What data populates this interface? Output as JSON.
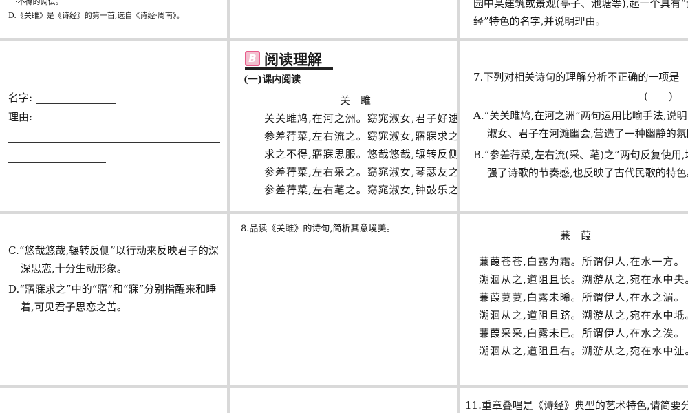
{
  "top_left_cell": {
    "line_fragment": "·不得的调伝。",
    "option_d_note": "D.《关雎》是《诗经》的第一首,选自《诗经·周南》。"
  },
  "top_right_cell": {
    "line1": "园中某建筑或景观(亭子、池塘等),起一个具有“诗",
    "line2": "经”特色的名字,并说明理由。"
  },
  "answer_cell": {
    "name_label": "名字:",
    "reason_label": "理由:"
  },
  "reading_section": {
    "badge_letter": "B",
    "title": "阅读理解",
    "subsection": "(一)课内阅读",
    "poem_title": "关　雎",
    "poem_lines": [
      "关关雎鸠,在河之洲。窈窕淑女,君子好逑。",
      "参差荇菜,左右流之。窈窕淑女,寤寐求之。",
      "求之不得,寤寐思服。悠哉悠哉,辗转反侧。",
      "参差荇菜,左右采之。窈窕淑女,琴瑟友之。",
      "参差荇菜,左右芼之。窈窕淑女,钟鼓乐之。"
    ]
  },
  "question7": {
    "stem": "7.下列对相关诗句的理解分析不正确的一项是",
    "bracket": "(　　)",
    "option_a_line1": "A.“关关雎鸠,在河之洲”两句运用比喻手法,说明",
    "option_a_line2": "淑女、君子在河滩幽会,营造了一种幽静的氛围。",
    "option_b_line1": "B.“参差荇菜,左右流(采、芼)之”两句反复使用,增",
    "option_b_line2": "强了诗歌的节奏感,也反映了古代民歌的特色。",
    "option_c_line1": "C.“悠哉悠哉,辗转反侧”以行动来反映君子的深",
    "option_c_line2": "深思恋,十分生动形象。",
    "option_d_line1": "D.“寤寐求之”中的“寤”和“寐”分别指醒来和睡",
    "option_d_line2": "着,可见君子思恋之苦。"
  },
  "question8": {
    "stem": "8.品读《关雎》的诗句,简析其意境美。"
  },
  "jianjia_poem": {
    "title": "蒹　葭",
    "lines": [
      "蒹葭苍苍,白露为霜。所谓伊人,在水一方。",
      "溯洄从之,道阻且长。溯游从之,宛在水中央。",
      "蒹葭萋萋,白露未晞。所谓伊人,在水之湄。",
      "溯洄从之,道阻且跻。溯游从之,宛在水中坻。",
      "蒹葭采采,白露未已。所谓伊人,在水之涘。",
      "溯洄从之,道阻且右。溯游从之,宛在水中沚。"
    ]
  },
  "question11": {
    "stem": "11.重章叠唱是《诗经》典型的艺术特色,请简要分析"
  }
}
